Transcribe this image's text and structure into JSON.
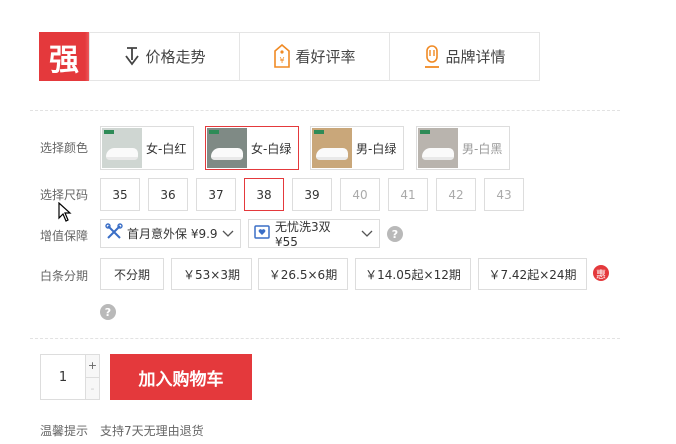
{
  "badge": {
    "label": "强"
  },
  "tabs": [
    {
      "label": "价格走势",
      "icon": "price-trend-icon"
    },
    {
      "label": "看好评率",
      "icon": "review-tag-icon"
    },
    {
      "label": "品牌详情",
      "icon": "brand-icon"
    }
  ],
  "labels": {
    "color": "选择颜色",
    "size": "选择尺码",
    "service": "增值保障",
    "installment": "白条分期",
    "tip": "温馨提示"
  },
  "colors": [
    {
      "label": "女-白红",
      "selected": false
    },
    {
      "label": "女-白绿",
      "selected": true
    },
    {
      "label": "男-白绿",
      "selected": false
    },
    {
      "label": "男-白黑",
      "selected": false
    }
  ],
  "sizes": [
    {
      "label": "35"
    },
    {
      "label": "36"
    },
    {
      "label": "37"
    },
    {
      "label": "38",
      "selected": true
    },
    {
      "label": "39"
    },
    {
      "label": "40"
    },
    {
      "label": "41"
    },
    {
      "label": "42"
    },
    {
      "label": "43"
    }
  ],
  "services": [
    {
      "label": "首月意外保 ¥9.9"
    },
    {
      "label": "无忧洗3双 ¥55"
    }
  ],
  "help_mark": "?",
  "installments": [
    {
      "label": "不分期"
    },
    {
      "label": "￥53×3期"
    },
    {
      "label": "￥26.5×6期"
    },
    {
      "label": "￥14.05起×12期"
    },
    {
      "label": "￥7.42起×24期"
    }
  ],
  "hui_badge": "惠",
  "quantity": {
    "value": "1",
    "plus": "+",
    "minus": "-"
  },
  "cart_button": "加入购物车",
  "tip_text": "支持7天无理由退货",
  "colors_hex": {
    "accent": "#e4393c",
    "border": "#dddddd",
    "tab_icon": "#f08a24"
  }
}
